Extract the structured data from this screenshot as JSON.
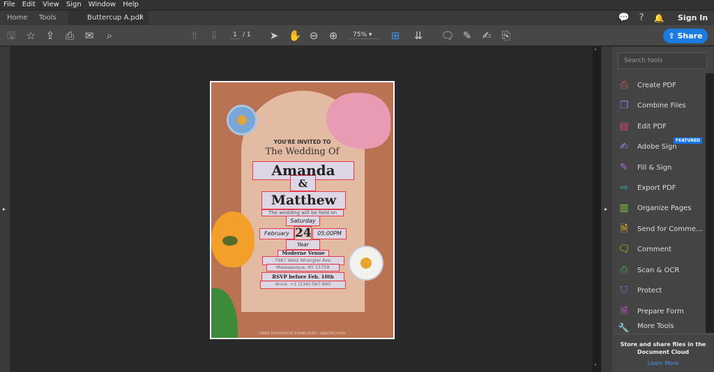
{
  "menu": [
    "File",
    "Edit",
    "View",
    "Sign",
    "Window",
    "Help"
  ],
  "tabs": {
    "home": "Home",
    "tools": "Tools",
    "document": "Buttercup A.pdf",
    "close": "×"
  },
  "header": {
    "sign_in": "Sign In"
  },
  "toolbar": {
    "page_current": "1",
    "page_total": "/ 1",
    "zoom": "75%",
    "share": "Share"
  },
  "invitation": {
    "invited": "YOU'RE INVITED TO",
    "wedding_of": "The Wedding Of",
    "name1": "Amanda",
    "amp": "&",
    "name2": "Matthew",
    "held_on": "The wedding will be held on",
    "day": "Saturday",
    "month": "February",
    "date": "24",
    "time": "05:00PM",
    "year": "Year",
    "venue": "Moderne Venue",
    "address1": "7987 West Wrangler Ave.",
    "address2": "Massapequa, NY 11758",
    "rsvp": "RSVP before Feb. 10th",
    "contact": "Anna: +1 (234)-567-890",
    "footer": "FREE INVITATION TEMPLATES - DREVIO.COM"
  },
  "panel": {
    "search_placeholder": "Search tools",
    "featured": "FEATURED",
    "tools": [
      {
        "label": "Create PDF",
        "color": "#e8595a"
      },
      {
        "label": "Combine Files",
        "color": "#8a7cf0"
      },
      {
        "label": "Edit PDF",
        "color": "#e0467a"
      },
      {
        "label": "Adobe Sign",
        "color": "#a77ce8"
      },
      {
        "label": "Fill & Sign",
        "color": "#b06be0"
      },
      {
        "label": "Export PDF",
        "color": "#2fb3b0"
      },
      {
        "label": "Organize Pages",
        "color": "#8ac43f"
      },
      {
        "label": "Send for Comme...",
        "color": "#f5c518"
      },
      {
        "label": "Comment",
        "color": "#f5c518"
      },
      {
        "label": "Scan & OCR",
        "color": "#3fb950"
      },
      {
        "label": "Protect",
        "color": "#7b7ce8"
      },
      {
        "label": "Prepare Form",
        "color": "#d05ad0"
      },
      {
        "label": "More Tools",
        "color": "#aaa"
      }
    ],
    "cloud_text": "Store and share files in the Document Cloud",
    "learn_more": "Learn More"
  }
}
